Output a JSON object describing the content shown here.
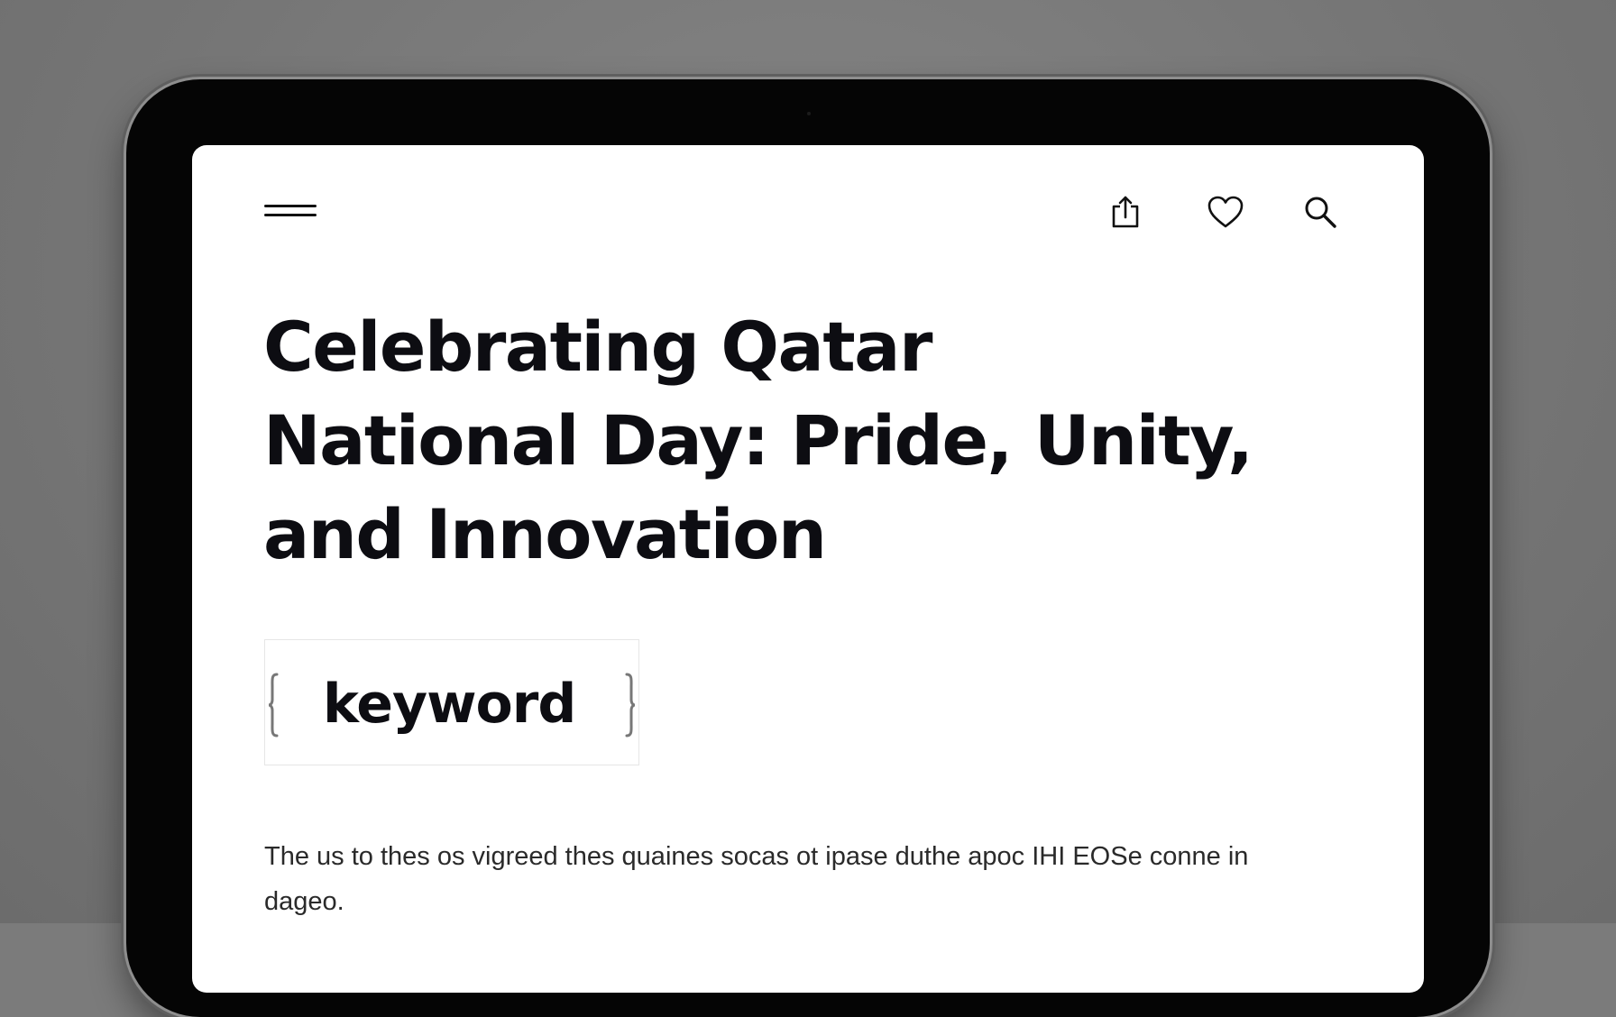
{
  "article": {
    "title": "Celebrating Qatar National Day: Pride, Unity, and Innovation",
    "keyword": "keyword",
    "body": "The us to thes os vigreed thes quaines socas ot ipase duthe apoc IHI EOSe conne in dageo."
  },
  "toolbar": {
    "menu_icon": "hamburger-menu-icon",
    "share_icon": "share-icon",
    "favorite_icon": "heart-icon",
    "search_icon": "search-icon"
  },
  "colors": {
    "background": "#7b7b7b",
    "device_frame": "#050505",
    "screen": "#ffffff",
    "text": "#0d0d12",
    "brace": "#777777"
  }
}
